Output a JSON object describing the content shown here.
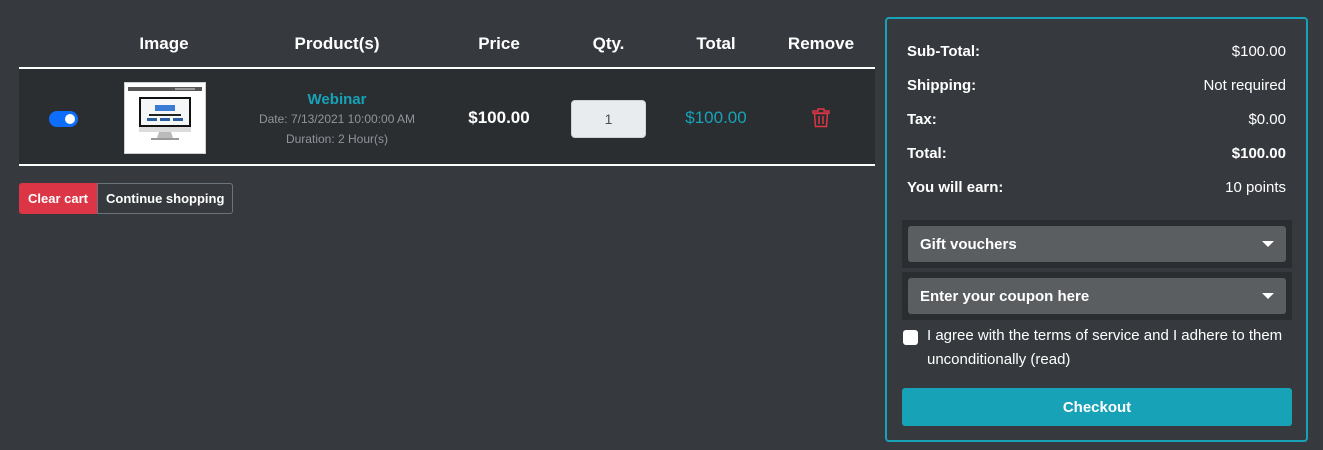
{
  "cart": {
    "headers": {
      "image": "Image",
      "products": "Product(s)",
      "price": "Price",
      "qty": "Qty.",
      "total": "Total",
      "remove": "Remove"
    },
    "items": [
      {
        "selected": true,
        "name": "Webinar",
        "date": "Date: 7/13/2021 10:00:00 AM",
        "duration": "Duration: 2 Hour(s)",
        "price": "$100.00",
        "qty": "1",
        "total": "$100.00",
        "remove_icon": "trash-icon"
      }
    ],
    "actions": {
      "clear": "Clear cart",
      "continue": "Continue shopping"
    }
  },
  "summary": {
    "subtotal_label": "Sub-Total:",
    "subtotal_value": "$100.00",
    "shipping_label": "Shipping:",
    "shipping_value": "Not required",
    "tax_label": "Tax:",
    "tax_value": "$0.00",
    "total_label": "Total:",
    "total_value": "$100.00",
    "earn_label": "You will earn:",
    "earn_value": "10 points",
    "gift_vouchers": "Gift vouchers",
    "coupon": "Enter your coupon here",
    "agree_text": "I agree with the terms of service and I adhere to them unconditionally (read)",
    "checkout": "Checkout"
  },
  "colors": {
    "background": "#363a3f",
    "accent": "#17a2b8",
    "danger": "#dc3545",
    "toggle": "#0d6efd"
  }
}
